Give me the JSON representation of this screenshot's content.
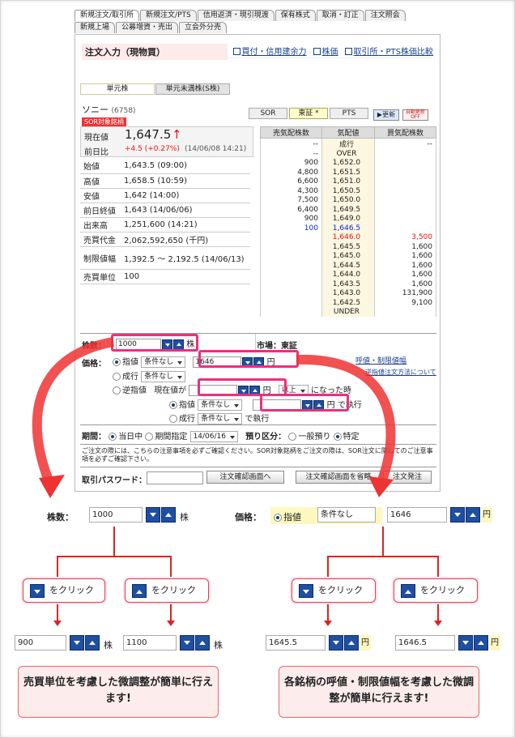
{
  "tabs_row1": [
    "新規注文/取引所",
    "新規注文/PTS",
    "信用返済・現引現渡",
    "保有株式",
    "取消・訂正",
    "注文照会"
  ],
  "tabs_row2": [
    "新規上場",
    "公募増資・売出",
    "立会外分売"
  ],
  "title": "注文入力（現物買）",
  "links": [
    "買付・信用建余力",
    "株価",
    "取引所・PTS株価比較"
  ],
  "subtabs": [
    "単元株",
    "単元未満株(S株)"
  ],
  "stock_name": "ソニー",
  "stock_code": "(6758)",
  "sor_badge": "SOR対象銘柄",
  "markets": [
    "SOR",
    "東証 *",
    "PTS"
  ],
  "btn_renew": "▶更新",
  "btn_auto": "自動更新 OFF",
  "quote": {
    "now_label": "現在値",
    "now_value": "1,647.5",
    "now_arrow": "↑",
    "prev_label": "前日比",
    "prev_value": "+4.5 (+0.27%)",
    "prev_time": "(14/06/08 14:21)",
    "rows": [
      [
        "始値",
        "1,643.5 (09:00)"
      ],
      [
        "高値",
        "1,658.5 (10:59)"
      ],
      [
        "安値",
        "1,642 (14:00)"
      ],
      [
        "前日終値",
        "1,643 (14/06/06)"
      ],
      [
        "出来高",
        "1,251,600 (14:21)"
      ],
      [
        "売買代金",
        "2,062,592,650 (千円)"
      ],
      [
        "制限値幅",
        "1,392.5 〜 2,192.5 (14/06/13)"
      ],
      [
        "売買単位",
        "100"
      ]
    ]
  },
  "board_headers": [
    "売気配株数",
    "気配値",
    "買気配株数"
  ],
  "board_rows": [
    [
      "--",
      "成行",
      "--"
    ],
    [
      "--",
      "OVER",
      ""
    ],
    [
      "900",
      "1,652.0",
      ""
    ],
    [
      "4,800",
      "1,651.5",
      ""
    ],
    [
      "6,600",
      "1,651.0",
      ""
    ],
    [
      "4,300",
      "1,650.5",
      ""
    ],
    [
      "7,500",
      "1,650.0",
      ""
    ],
    [
      "6,400",
      "1,649.5",
      ""
    ],
    [
      "900",
      "1,649.0",
      ""
    ],
    [
      "100",
      "1,646.5",
      ""
    ],
    [
      "",
      "1,646.0",
      "3,500"
    ],
    [
      "",
      "1,645.5",
      "1,600"
    ],
    [
      "",
      "1,645.0",
      "1,600"
    ],
    [
      "",
      "1,644.5",
      "1,600"
    ],
    [
      "",
      "1,644.0",
      "1,600"
    ],
    [
      "",
      "1,643.5",
      "1,600"
    ],
    [
      "",
      "1,643.0",
      "131,900"
    ],
    [
      "",
      "1,642.5",
      "9,100"
    ],
    [
      "",
      "UNDER",
      ""
    ]
  ],
  "form": {
    "qty_label": "株数：",
    "qty_value": "1000",
    "qty_unit": "株",
    "market_label": "市場：東証",
    "price_label": "価格：",
    "limit": "指値",
    "cond": "条件なし",
    "price_value": "1646",
    "yen": "円",
    "tick_link": "呼値・制限値幅",
    "market_order": "成行",
    "stop": "逆指値",
    "stop_text": "現在値が",
    "above": "以上",
    "became": "になった時",
    "exec_text": "で執行",
    "period_label": "期間：",
    "today": "当日中",
    "period_spec": "期間指定",
    "date": "14/06/16",
    "deposit_label": "預り区分：",
    "general": "一般預り",
    "specific": "特定",
    "notice_link": "逆指値注文方法について",
    "notice": "ご注文の際には、こちらの注意事項を必ずご確認ください。SOR対象銘柄をご注文の際は、SOR注文に関してのご注意事項を必ずご確認下さい。",
    "pw_label": "取引パスワード：",
    "btn_confirm": "注文確認画面へ",
    "btn_skip": "注文確認画面を省略",
    "btn_order": "注文発注"
  },
  "lower": {
    "qty_label": "株数：",
    "qty": "1000",
    "unit": "株",
    "price_label": "価格：",
    "limit": "指値",
    "cond": "条件なし",
    "price": "1646",
    "yen": "円",
    "click": "をクリック",
    "qty_down": "900",
    "qty_up": "1100",
    "price_down": "1645.5",
    "price_up": "1646.5",
    "msg_left": "売買単位を考慮した微調整が簡単に行えます!",
    "msg_right": "各銘柄の呼値・制限値幅を考慮した微調整が簡単に行えます!"
  },
  "colors": {
    "accent_pink": "#e9317d",
    "red": "#d22",
    "spin_blue": "#1f4fa0"
  }
}
